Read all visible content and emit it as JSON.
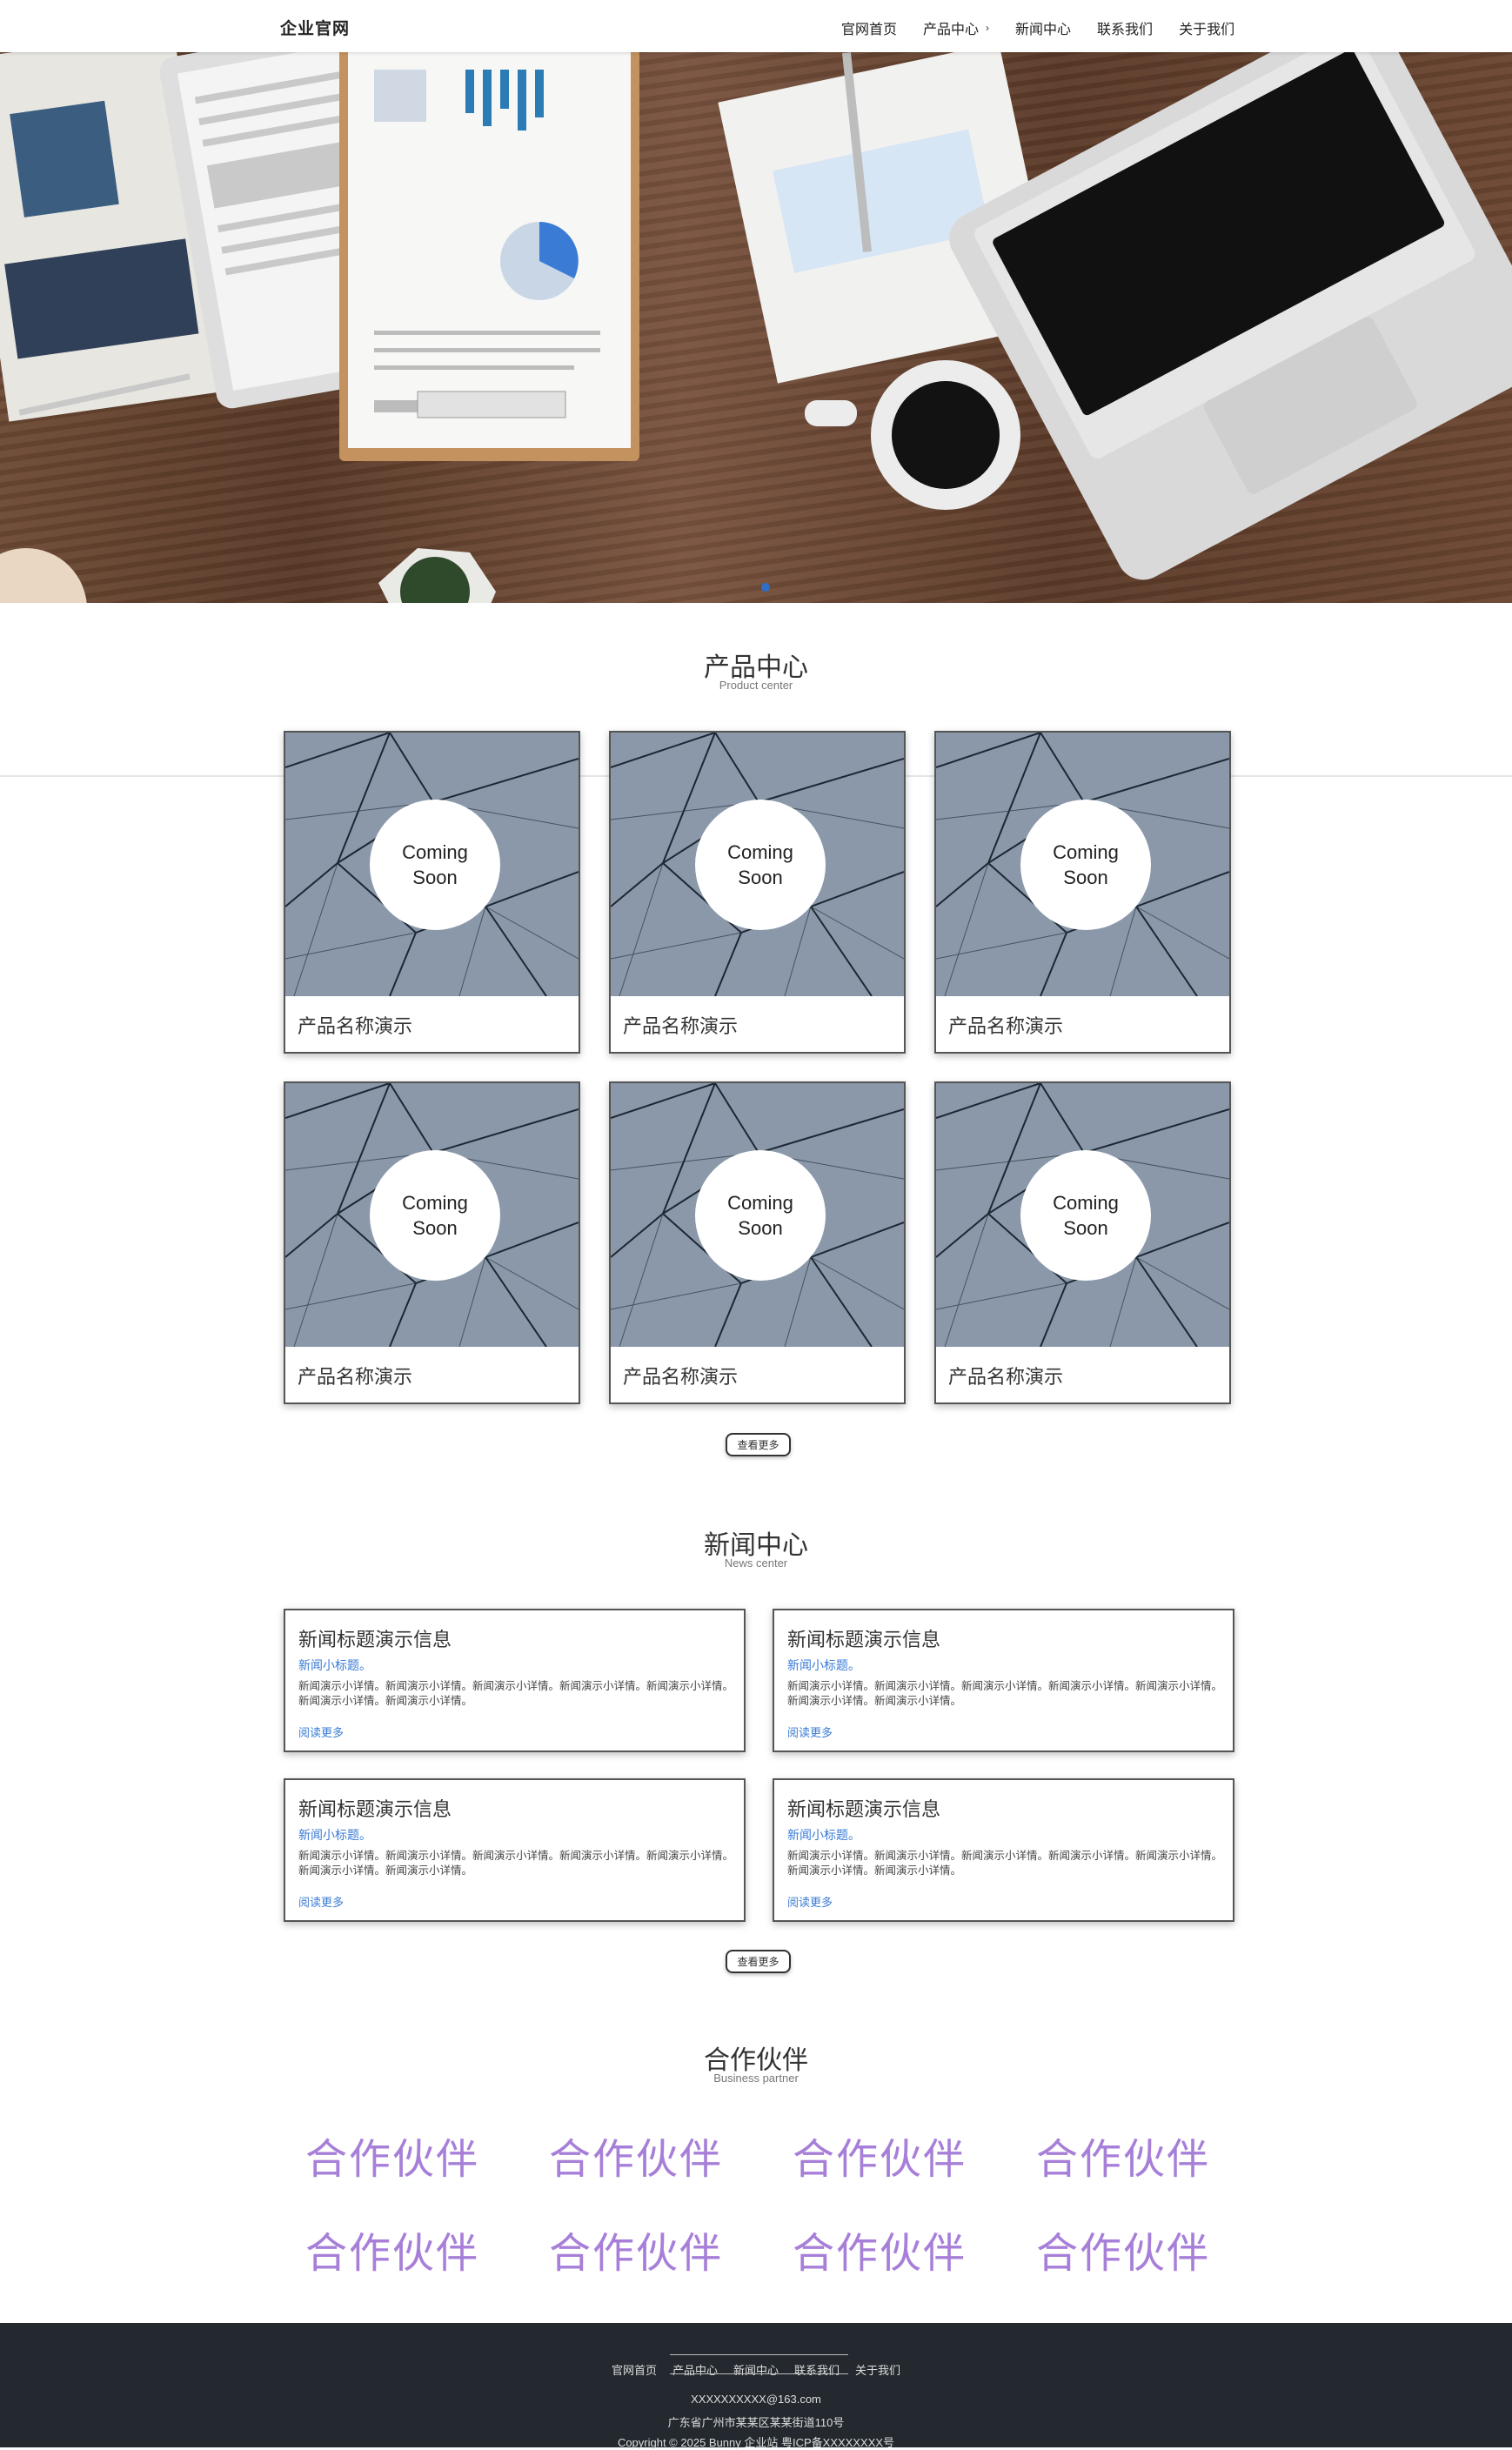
{
  "nav": {
    "brand": "企业官网",
    "items": [
      {
        "label": "官网首页"
      },
      {
        "label": "产品中心"
      },
      {
        "label": "新闻中心"
      },
      {
        "label": "联系我们"
      },
      {
        "label": "关于我们"
      }
    ]
  },
  "hero": {
    "carousel_index": 1,
    "carousel_count": 1
  },
  "products": {
    "title": "产品中心",
    "subtitle": "Product center",
    "items": [
      {
        "badge": "Coming Soon",
        "name": "产品名称演示"
      },
      {
        "badge": "Coming Soon",
        "name": "产品名称演示"
      },
      {
        "badge": "Coming Soon",
        "name": "产品名称演示"
      },
      {
        "badge": "Coming Soon",
        "name": "产品名称演示"
      },
      {
        "badge": "Coming Soon",
        "name": "产品名称演示"
      },
      {
        "badge": "Coming Soon",
        "name": "产品名称演示"
      }
    ],
    "more_label": "查看更多"
  },
  "news": {
    "title": "新闻中心",
    "subtitle": "News center",
    "items": [
      {
        "title": "新闻标题演示信息",
        "subtitle": "新闻小标题。",
        "desc": "新闻演示小详情。新闻演示小详情。新闻演示小详情。新闻演示小详情。新闻演示小详情。新闻演示小详情。新闻演示小详情。",
        "link": "阅读更多"
      },
      {
        "title": "新闻标题演示信息",
        "subtitle": "新闻小标题。",
        "desc": "新闻演示小详情。新闻演示小详情。新闻演示小详情。新闻演示小详情。新闻演示小详情。新闻演示小详情。新闻演示小详情。",
        "link": "阅读更多"
      },
      {
        "title": "新闻标题演示信息",
        "subtitle": "新闻小标题。",
        "desc": "新闻演示小详情。新闻演示小详情。新闻演示小详情。新闻演示小详情。新闻演示小详情。新闻演示小详情。新闻演示小详情。",
        "link": "阅读更多"
      },
      {
        "title": "新闻标题演示信息",
        "subtitle": "新闻小标题。",
        "desc": "新闻演示小详情。新闻演示小详情。新闻演示小详情。新闻演示小详情。新闻演示小详情。新闻演示小详情。新闻演示小详情。",
        "link": "阅读更多"
      }
    ],
    "more_label": "查看更多"
  },
  "partners": {
    "title": "合作伙伴",
    "subtitle": "Business partner",
    "items": [
      "合作伙伴",
      "合作伙伴",
      "合作伙伴",
      "合作伙伴",
      "合作伙伴",
      "合作伙伴",
      "合作伙伴",
      "合作伙伴"
    ],
    "color": "#a77fd8"
  },
  "footer": {
    "nav": [
      "官网首页",
      "产品中心",
      "新闻中心",
      "联系我们",
      "关于我们"
    ],
    "email": "XXXXXXXXXX@163.com",
    "address": "广东省广州市某某区某某街道110号",
    "copyright": "Copyright © 2025 Bunny 企业站 粤ICP备XXXXXXXX号"
  },
  "colors": {
    "link": "#3a7bd5",
    "footer_bg": "#24292f",
    "carousel_dot": "#2d6fc7"
  }
}
